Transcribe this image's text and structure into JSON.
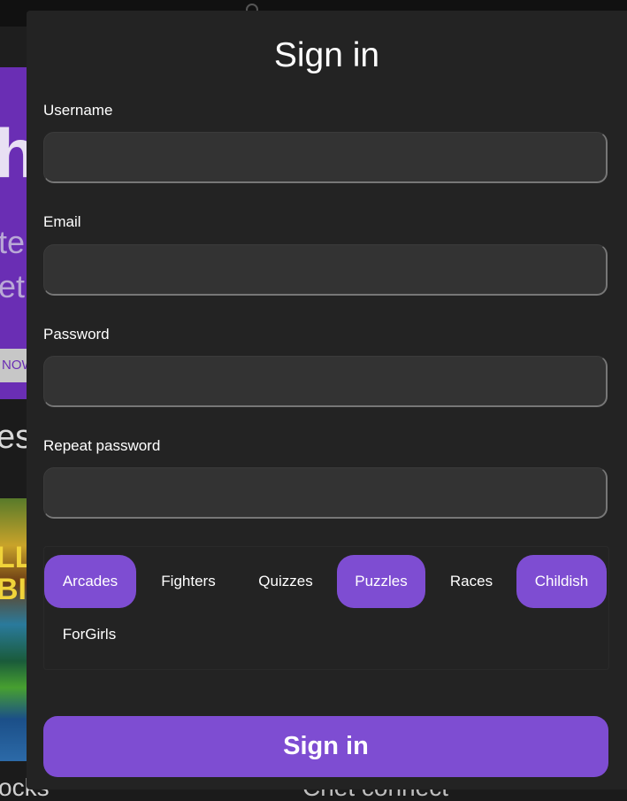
{
  "background": {
    "hero_big_text": "h",
    "hero_line_1": "te",
    "hero_line_2": "et",
    "hero_button": "NOW",
    "section_title": "es",
    "thumb_text_1": "LL",
    "thumb_text_2": "BI",
    "bottom_left_text": "ocks",
    "bottom_right_text": "Chet connect"
  },
  "modal": {
    "title": "Sign in",
    "fields": [
      {
        "label": "Username",
        "value": "",
        "placeholder": ""
      },
      {
        "label": "Email",
        "value": "",
        "placeholder": ""
      },
      {
        "label": "Password",
        "value": "",
        "placeholder": ""
      },
      {
        "label": "Repeat password",
        "value": "",
        "placeholder": ""
      }
    ],
    "tags": [
      {
        "label": "Arcades",
        "selected": true
      },
      {
        "label": "Fighters",
        "selected": false
      },
      {
        "label": "Quizzes",
        "selected": false
      },
      {
        "label": "Puzzles",
        "selected": true
      },
      {
        "label": "Races",
        "selected": false
      },
      {
        "label": "Childish",
        "selected": true
      },
      {
        "label": "ForGirls",
        "selected": false
      }
    ],
    "submit_label": "Sign in"
  },
  "colors": {
    "accent": "#7e4dd2",
    "modal_bg": "#232323",
    "input_bg": "#333333",
    "hero_bg": "#6a2eb4"
  }
}
